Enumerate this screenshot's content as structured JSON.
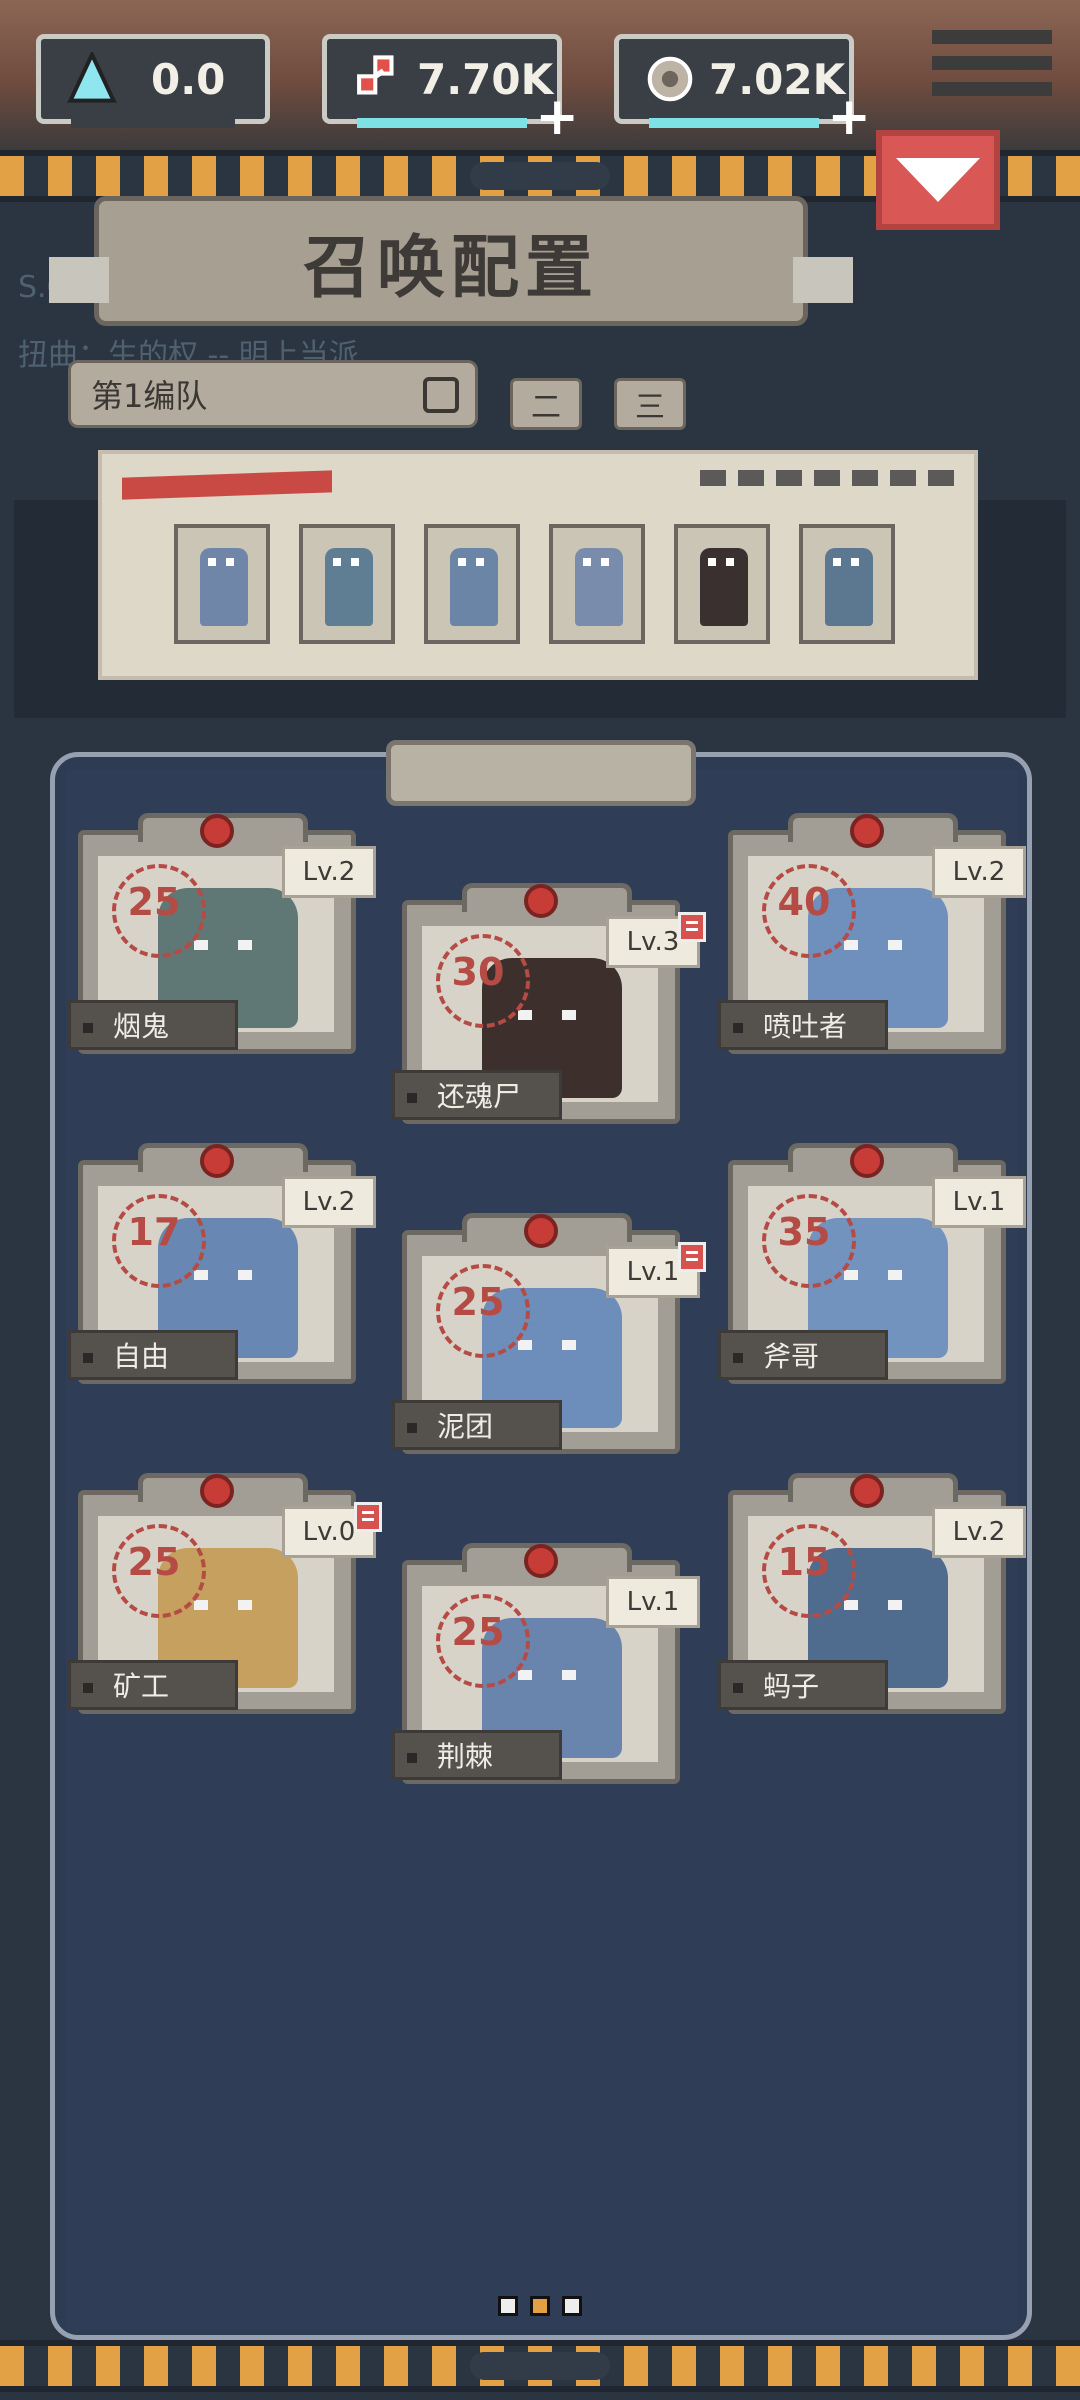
{
  "resources": [
    {
      "id": "shards",
      "icon": "crystal-icon",
      "value": "0.0",
      "has_plus": false
    },
    {
      "id": "bones",
      "icon": "bone-resource-icon",
      "value": "7.70K",
      "has_plus": true
    },
    {
      "id": "coins",
      "icon": "coin-resource-icon",
      "value": "7.02K",
      "has_plus": true
    }
  ],
  "header": {
    "title": "召唤配置",
    "faded_line1": "S.O.T",
    "faded_line2": "扭曲：生的权 -- 明上当派"
  },
  "team": {
    "current_label": "第1编队",
    "tabs": [
      "二",
      "三"
    ]
  },
  "formation": {
    "slots": [
      {
        "unit": "blue-ghoul",
        "color": "#6f86a8"
      },
      {
        "unit": "spiky-ghoul",
        "color": "#5f7d93"
      },
      {
        "unit": "crawler-ghoul",
        "color": "#6b85a6"
      },
      {
        "unit": "winged-ghoul",
        "color": "#7a8cab"
      },
      {
        "unit": "red-eyed-zombie",
        "color": "#3a3030"
      },
      {
        "unit": "horned-ghoul",
        "color": "#5c7891"
      }
    ]
  },
  "units": [
    {
      "name": "烟鬼",
      "cost": "25",
      "level": "Lv.2",
      "alert": false,
      "art_color": "#5f7876"
    },
    {
      "name": "还魂尸",
      "cost": "30",
      "level": "Lv.3",
      "alert": true,
      "art_color": "#3d302c"
    },
    {
      "name": "喷吐者",
      "cost": "40",
      "level": "Lv.2",
      "alert": false,
      "art_color": "#6f8fbd"
    },
    {
      "name": "自由",
      "cost": "17",
      "level": "Lv.2",
      "alert": false,
      "art_color": "#6888b3"
    },
    {
      "name": "泥团",
      "cost": "25",
      "level": "Lv.1",
      "alert": true,
      "art_color": "#6d8dbb"
    },
    {
      "name": "斧哥",
      "cost": "35",
      "level": "Lv.1",
      "alert": false,
      "art_color": "#7393bf"
    },
    {
      "name": "矿工",
      "cost": "25",
      "level": "Lv.0",
      "alert": true,
      "art_color": "#c6a05e"
    },
    {
      "name": "荆棘",
      "cost": "25",
      "level": "Lv.1",
      "alert": false,
      "art_color": "#6a85ad"
    },
    {
      "name": "蚂子",
      "cost": "15",
      "level": "Lv.2",
      "alert": false,
      "art_color": "#4f6b8e"
    }
  ],
  "pager": {
    "pages": 3,
    "current": 2
  },
  "colors": {
    "accent_orange": "#e3a145",
    "alert_red": "#d95856",
    "board_blue": "#2f3e56"
  }
}
